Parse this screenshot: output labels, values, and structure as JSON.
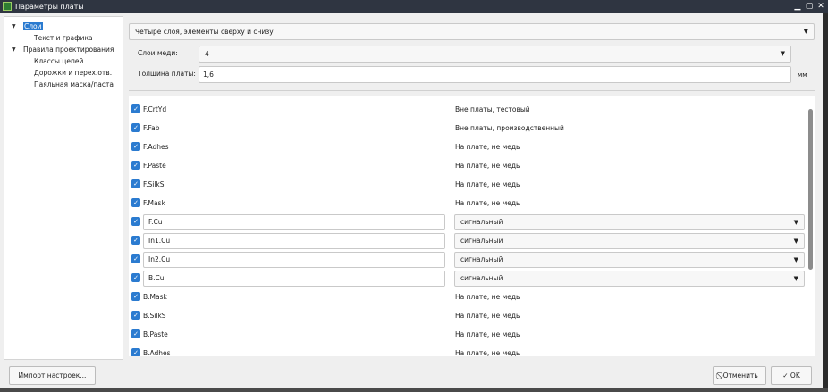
{
  "window": {
    "title": "Параметры платы",
    "min_glyph": "▁",
    "max_glyph": "▢",
    "close_glyph": "✕"
  },
  "tree": [
    {
      "label": "Слои",
      "level": 0,
      "selected": true,
      "arrow": "▼"
    },
    {
      "label": "Текст и графика",
      "level": 1
    },
    {
      "label": "Правила проектирования",
      "level": 0,
      "arrow": "▼"
    },
    {
      "label": "Классы цепей",
      "level": 1
    },
    {
      "label": "Дорожки и перех.отв.",
      "level": 1
    },
    {
      "label": "Паяльная маска/паста",
      "level": 1
    }
  ],
  "board": {
    "preset": "Четыре слоя, элементы сверху и снизу",
    "copper_label": "Слои меди:",
    "copper_value": "4",
    "thickness_label": "Толщина платы:",
    "thickness_value": "1,6",
    "thickness_unit": "мм"
  },
  "layers": [
    {
      "name": "F.CrtYd",
      "type": "Вне платы, тестовый",
      "checked": true,
      "editable": false
    },
    {
      "name": "F.Fab",
      "type": "Вне платы, производственный",
      "checked": true,
      "editable": false
    },
    {
      "name": "F.Adhes",
      "type": "На плате, не медь",
      "checked": true,
      "editable": false
    },
    {
      "name": "F.Paste",
      "type": "На плате, не медь",
      "checked": true,
      "editable": false
    },
    {
      "name": "F.SilkS",
      "type": "На плате, не медь",
      "checked": true,
      "editable": false
    },
    {
      "name": "F.Mask",
      "type": "На плате, не медь",
      "checked": true,
      "editable": false
    },
    {
      "name": "F.Cu",
      "type": "сигнальный",
      "checked": true,
      "editable": true
    },
    {
      "name": "In1.Cu",
      "type": "сигнальный",
      "checked": true,
      "editable": true
    },
    {
      "name": "In2.Cu",
      "type": "сигнальный",
      "checked": true,
      "editable": true
    },
    {
      "name": "B.Cu",
      "type": "сигнальный",
      "checked": true,
      "editable": true
    },
    {
      "name": "B.Mask",
      "type": "На плате, не медь",
      "checked": true,
      "editable": false
    },
    {
      "name": "B.SilkS",
      "type": "На плате, не медь",
      "checked": true,
      "editable": false
    },
    {
      "name": "B.Paste",
      "type": "На плате, не медь",
      "checked": true,
      "editable": false
    },
    {
      "name": "B.Adhes",
      "type": "На плате, не медь",
      "checked": true,
      "editable": false
    }
  ],
  "buttons": {
    "import": "Импорт настроек...",
    "cancel": "Отменить",
    "ok": "OK",
    "cancel_icon": "⃠",
    "ok_icon": "✓"
  },
  "colors": {
    "accent": "#2b7bd0",
    "titlebar": "#2f3541"
  }
}
